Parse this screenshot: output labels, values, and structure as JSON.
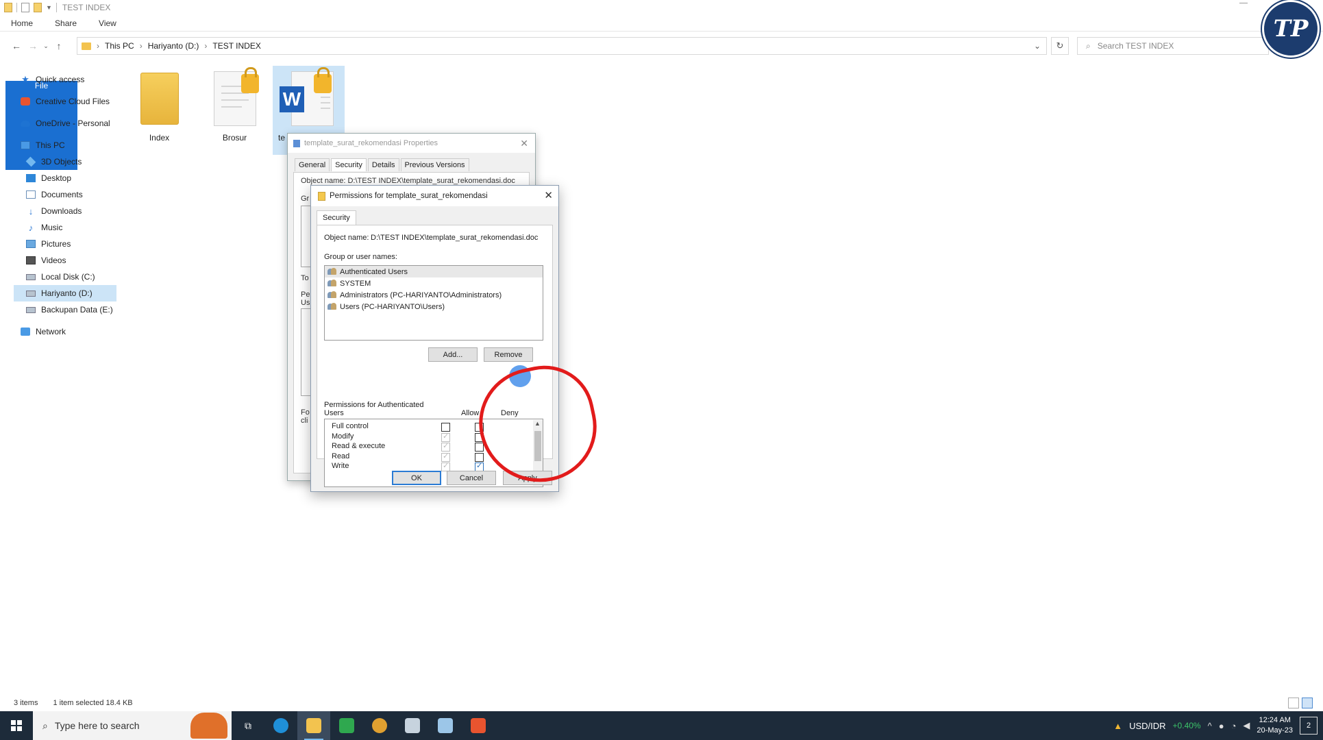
{
  "window": {
    "title": "TEST INDEX"
  },
  "ribbon": {
    "tabs": [
      "File",
      "Home",
      "Share",
      "View"
    ]
  },
  "address": {
    "crumbs": [
      "This PC",
      "Hariyanto (D:)",
      "TEST INDEX"
    ],
    "search_placeholder": "Search TEST INDEX"
  },
  "logo_text": "TP",
  "sidebar": {
    "items": [
      {
        "label": "Quick access",
        "icon": "star-icon"
      },
      {
        "label": "Creative Cloud Files",
        "icon": "creative-cloud-icon"
      },
      {
        "label": "OneDrive - Personal",
        "icon": "cloud-icon"
      },
      {
        "label": "This PC",
        "icon": "pc-icon"
      },
      {
        "label": "3D Objects",
        "icon": "3d-objects-icon"
      },
      {
        "label": "Desktop",
        "icon": "desktop-icon"
      },
      {
        "label": "Documents",
        "icon": "documents-icon"
      },
      {
        "label": "Downloads",
        "icon": "download-icon"
      },
      {
        "label": "Music",
        "icon": "music-icon"
      },
      {
        "label": "Pictures",
        "icon": "pictures-icon"
      },
      {
        "label": "Videos",
        "icon": "videos-icon"
      },
      {
        "label": "Local Disk (C:)",
        "icon": "drive-icon"
      },
      {
        "label": "Hariyanto (D:)",
        "icon": "drive-icon"
      },
      {
        "label": "Backupan Data (E:)",
        "icon": "drive-icon"
      },
      {
        "label": "Network",
        "icon": "network-icon"
      }
    ]
  },
  "files": [
    {
      "name": "Index"
    },
    {
      "name": "Brosur"
    },
    {
      "name": "te"
    }
  ],
  "properties_dialog": {
    "title": "template_surat_rekomendasi Properties",
    "tabs": [
      "General",
      "Security",
      "Details",
      "Previous Versions"
    ],
    "frag_object": "Object name:   D:\\TEST INDEX\\template_surat_rekomendasi.doc",
    "frag_gr": "Gr",
    "frag_to": "To",
    "frag_pe": "Pe",
    "frag_us": "Us",
    "frag_fo": "Fo",
    "frag_cli": "cli"
  },
  "permissions_dialog": {
    "title": "Permissions for template_surat_rekomendasi",
    "tab": "Security",
    "object_label": "Object name:",
    "object_value": "D:\\TEST INDEX\\template_surat_rekomendasi.doc",
    "group_label": "Group or user names:",
    "users": [
      "Authenticated Users",
      "SYSTEM",
      "Administrators (PC-HARIYANTO\\Administrators)",
      "Users (PC-HARIYANTO\\Users)"
    ],
    "add_label": "Add...",
    "remove_label": "Remove",
    "perm_for_label": "Permissions for Authenticated Users",
    "allow_label": "Allow",
    "deny_label": "Deny",
    "permissions": [
      {
        "name": "Full control",
        "allow": false,
        "allow_grey": false,
        "deny": false
      },
      {
        "name": "Modify",
        "allow": true,
        "allow_grey": true,
        "deny": false
      },
      {
        "name": "Read & execute",
        "allow": true,
        "allow_grey": true,
        "deny": false
      },
      {
        "name": "Read",
        "allow": true,
        "allow_grey": true,
        "deny": false
      },
      {
        "name": "Write",
        "allow": true,
        "allow_grey": true,
        "deny": true
      }
    ],
    "ok_label": "OK",
    "cancel_label": "Cancel",
    "apply_label": "Apply"
  },
  "status": {
    "items": "3 items",
    "selection": "1 item selected  18.4 KB"
  },
  "taskbar": {
    "search_placeholder": "Type here to search",
    "ticker": "USD/IDR",
    "ticker_change": "+0.40%",
    "time": "12:24 AM",
    "date": "20-May-23",
    "notif_count": "2",
    "colors": {
      "edge": "#1f8fd8",
      "explorer": "#f3c34f",
      "camtasia": "#2fa84f",
      "chrome": "#e0a030",
      "app5": "#c7d3de",
      "app6": "#9cc6e8",
      "app7": "#e8542f"
    }
  }
}
